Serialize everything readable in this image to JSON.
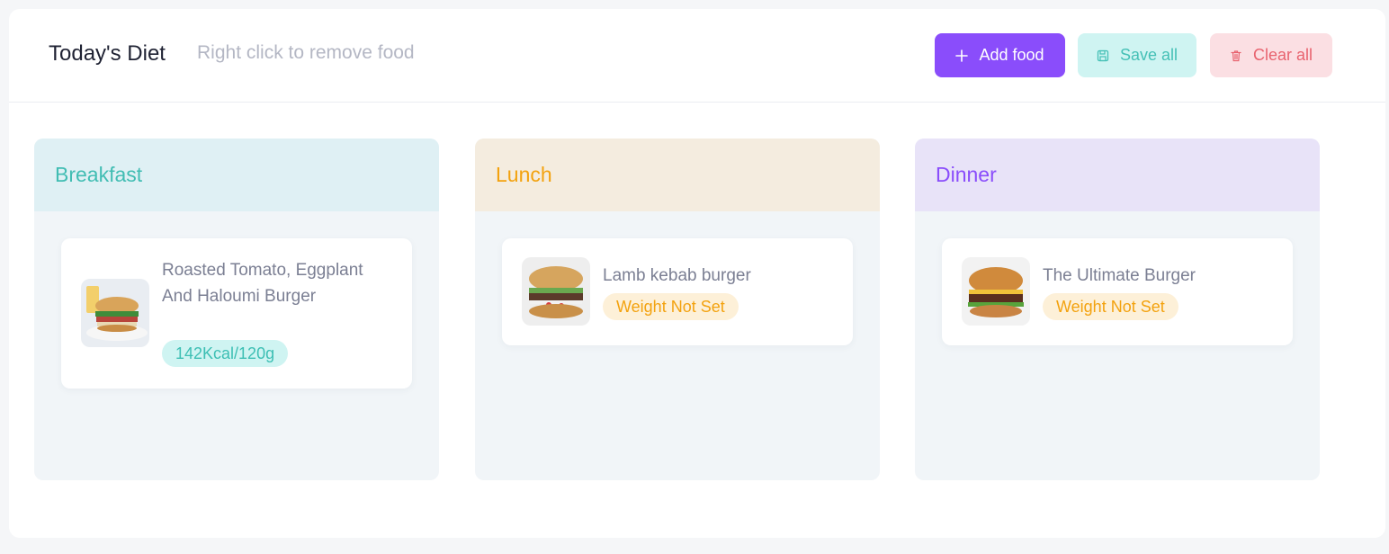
{
  "header": {
    "title": "Today's Diet",
    "hint": "Right click to remove food",
    "buttons": {
      "add": {
        "label": "Add food",
        "icon": "plus-icon"
      },
      "save": {
        "label": "Save all",
        "icon": "floppy-disk-icon"
      },
      "clear": {
        "label": "Clear all",
        "icon": "trash-icon"
      }
    }
  },
  "colors": {
    "accent": "#8a4dfb",
    "teal": "#41bdb3",
    "orange": "#f3a20f",
    "red": "#e8636f"
  },
  "meals": [
    {
      "title": "Breakfast",
      "foods": [
        {
          "name": "Roasted Tomato, Eggplant And Haloumi Burger",
          "badge": "142Kcal/120g",
          "image": "burger-photo"
        }
      ]
    },
    {
      "title": "Lunch",
      "foods": [
        {
          "name": "Lamb kebab burger",
          "badge": "Weight Not Set",
          "image": "burger-photo"
        }
      ]
    },
    {
      "title": "Dinner",
      "foods": [
        {
          "name": "The Ultimate Burger",
          "badge": "Weight Not Set",
          "image": "burger-photo"
        }
      ]
    }
  ]
}
